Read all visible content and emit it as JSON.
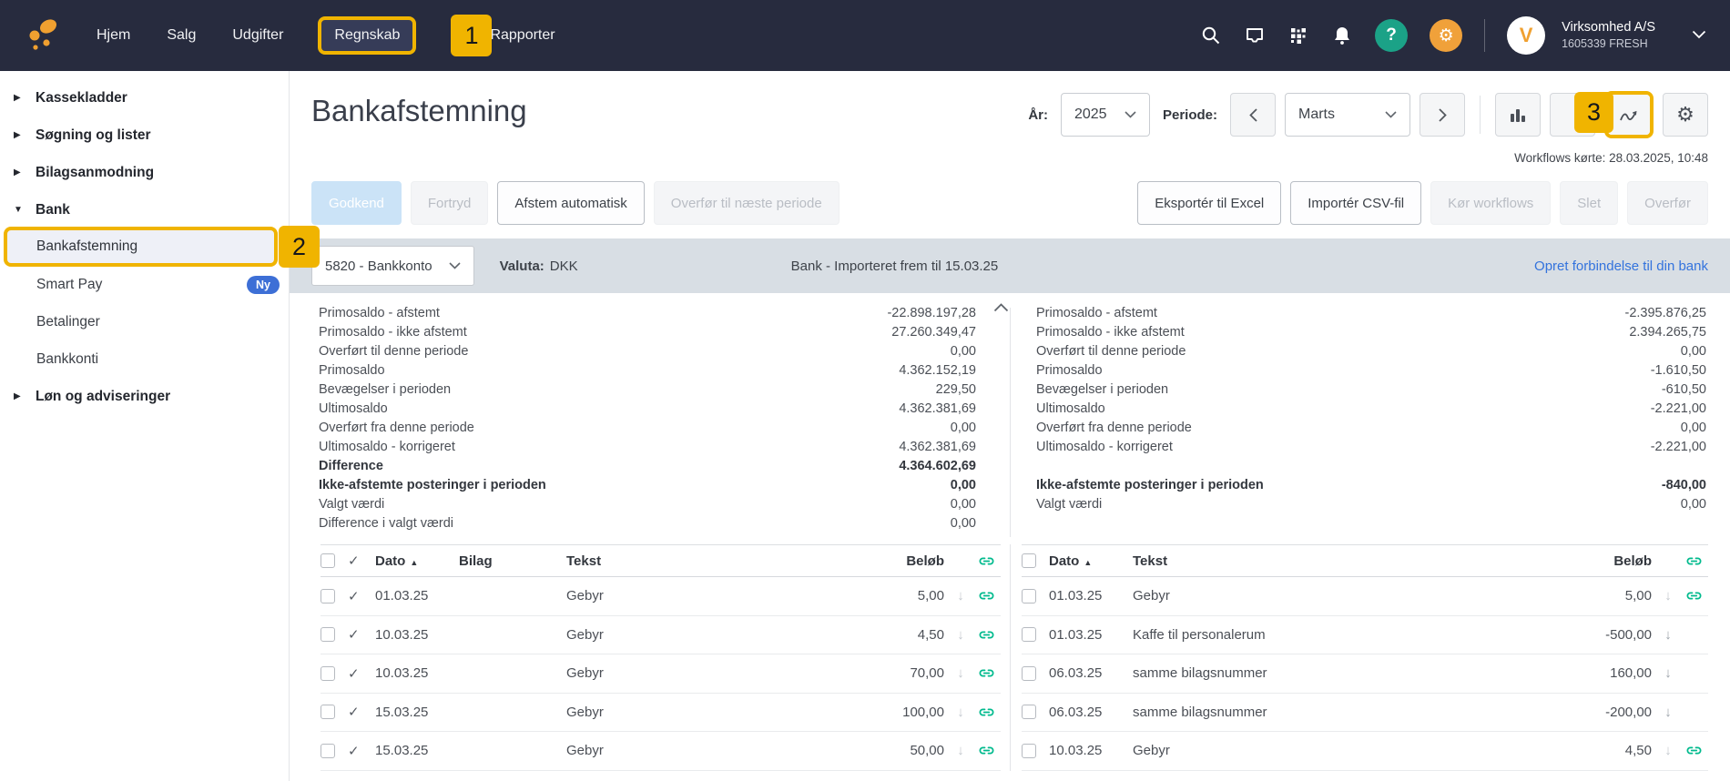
{
  "topbar": {
    "nav": [
      {
        "label": "Hjem"
      },
      {
        "label": "Salg"
      },
      {
        "label": "Udgifter"
      },
      {
        "label": "Regnskab",
        "active": true,
        "annotation": "1"
      },
      {
        "label": "Rapporter",
        "partially_covered": true
      }
    ],
    "company_name": "Virksomhed A/S",
    "company_id": "1605339 FRESH",
    "avatar_letter": "V"
  },
  "sidebar": {
    "groups": [
      {
        "label": "Kassekladder",
        "expanded": false
      },
      {
        "label": "Søgning og lister",
        "expanded": false
      },
      {
        "label": "Bilagsanmodning",
        "expanded": false
      },
      {
        "label": "Bank",
        "expanded": true,
        "children": [
          {
            "label": "Bankafstemning",
            "selected": true,
            "annotation": "2"
          },
          {
            "label": "Smart Pay",
            "badge": "Ny"
          },
          {
            "label": "Betalinger"
          },
          {
            "label": "Bankkonti"
          }
        ]
      },
      {
        "label": "Løn og adviseringer",
        "expanded": false
      }
    ]
  },
  "page": {
    "title": "Bankafstemning",
    "year_label": "År:",
    "year_value": "2025",
    "period_label": "Periode:",
    "period_value": "Marts",
    "annotation": "3",
    "workflows_note": "Workflows kørte: 28.03.2025, 10:48"
  },
  "actions": {
    "left": [
      {
        "label": "Godkend",
        "style": "primary-disabled"
      },
      {
        "label": "Fortryd",
        "style": "disabled"
      },
      {
        "label": "Afstem automatisk",
        "style": "normal"
      },
      {
        "label": "Overfør til næste periode",
        "style": "disabled"
      }
    ],
    "right": [
      {
        "label": "Eksportér til Excel",
        "style": "normal"
      },
      {
        "label": "Importér CSV-fil",
        "style": "normal"
      },
      {
        "label": "Kør workflows",
        "style": "disabled"
      },
      {
        "label": "Slet",
        "style": "disabled"
      },
      {
        "label": "Overfør",
        "style": "disabled"
      }
    ]
  },
  "bank_bar": {
    "account": "5820 - Bankkonto",
    "currency_label": "Valuta:",
    "currency": "DKK",
    "status": "Bank - Importeret frem til 15.03.25",
    "connect_link": "Opret forbindelse til din bank"
  },
  "summary": {
    "left_rows": [
      {
        "label": "Primosaldo - afstemt",
        "value": "-22.898.197,28"
      },
      {
        "label": "Primosaldo - ikke afstemt",
        "value": "27.260.349,47"
      },
      {
        "label": "Overført til denne periode",
        "value": "0,00"
      },
      {
        "label": "Primosaldo",
        "value": "4.362.152,19"
      },
      {
        "label": "Bevægelser i perioden",
        "value": "229,50"
      },
      {
        "label": "Ultimosaldo",
        "value": "4.362.381,69"
      },
      {
        "label": "Overført fra denne periode",
        "value": "0,00"
      },
      {
        "label": "Ultimosaldo - korrigeret",
        "value": "4.362.381,69"
      },
      {
        "label": "Difference",
        "value": "4.364.602,69",
        "bold": true
      },
      {
        "label": "Ikke-afstemte posteringer i perioden",
        "value": "0,00",
        "bold": true
      },
      {
        "label": "Valgt værdi",
        "value": "0,00"
      },
      {
        "label": "Difference i valgt værdi",
        "value": "0,00"
      }
    ],
    "right_rows": [
      {
        "label": "Primosaldo - afstemt",
        "value": "-2.395.876,25"
      },
      {
        "label": "Primosaldo - ikke afstemt",
        "value": "2.394.265,75"
      },
      {
        "label": "Overført til denne periode",
        "value": "0,00"
      },
      {
        "label": "Primosaldo",
        "value": "-1.610,50"
      },
      {
        "label": "Bevægelser i perioden",
        "value": "-610,50"
      },
      {
        "label": "Ultimosaldo",
        "value": "-2.221,00"
      },
      {
        "label": "Overført fra denne periode",
        "value": "0,00"
      },
      {
        "label": "Ultimosaldo - korrigeret",
        "value": "-2.221,00"
      },
      {
        "label": "",
        "value": "",
        "spacer": true
      },
      {
        "label": "Ikke-afstemte posteringer i perioden",
        "value": "-840,00",
        "bold": true
      },
      {
        "label": "Valgt værdi",
        "value": "0,00"
      }
    ]
  },
  "reconciliation": {
    "left_table": {
      "headers": {
        "date": "Dato",
        "voucher": "Bilag",
        "text": "Tekst",
        "amount": "Beløb"
      },
      "rows": [
        {
          "date": "01.03.25",
          "voucher": "",
          "text": "Gebyr",
          "amount": "5,00",
          "checked": true,
          "link": true
        },
        {
          "date": "10.03.25",
          "voucher": "",
          "text": "Gebyr",
          "amount": "4,50",
          "checked": true,
          "link": true
        },
        {
          "date": "10.03.25",
          "voucher": "",
          "text": "Gebyr",
          "amount": "70,00",
          "checked": true,
          "link": true
        },
        {
          "date": "15.03.25",
          "voucher": "",
          "text": "Gebyr",
          "amount": "100,00",
          "checked": true,
          "link": true
        },
        {
          "date": "15.03.25",
          "voucher": "",
          "text": "Gebyr",
          "amount": "50,00",
          "checked": true,
          "link": true
        }
      ]
    },
    "right_table": {
      "headers": {
        "date": "Dato",
        "text": "Tekst",
        "amount": "Beløb"
      },
      "rows": [
        {
          "date": "01.03.25",
          "text": "Gebyr",
          "amount": "5,00",
          "link": true,
          "strong_arrow": false
        },
        {
          "date": "01.03.25",
          "text": "Kaffe til personalerum",
          "amount": "-500,00",
          "link": false,
          "strong_arrow": true
        },
        {
          "date": "06.03.25",
          "text": "samme bilagsnummer",
          "amount": "160,00",
          "link": false,
          "strong_arrow": true
        },
        {
          "date": "06.03.25",
          "text": "samme bilagsnummer",
          "amount": "-200,00",
          "link": false,
          "strong_arrow": true
        },
        {
          "date": "10.03.25",
          "text": "Gebyr",
          "amount": "4,50",
          "link": true,
          "strong_arrow": false
        }
      ]
    }
  },
  "colors": {
    "topbar": "#272b3e",
    "annotation": "#f0b400",
    "brand_orange": "#f0a030",
    "help_green": "#1ba287",
    "settings_orange": "#f0a13a",
    "link_green": "#00ba8d",
    "link_blue": "#3373dd",
    "ny_badge": "#3d6fd6",
    "bank_band": "#d8dee4"
  }
}
